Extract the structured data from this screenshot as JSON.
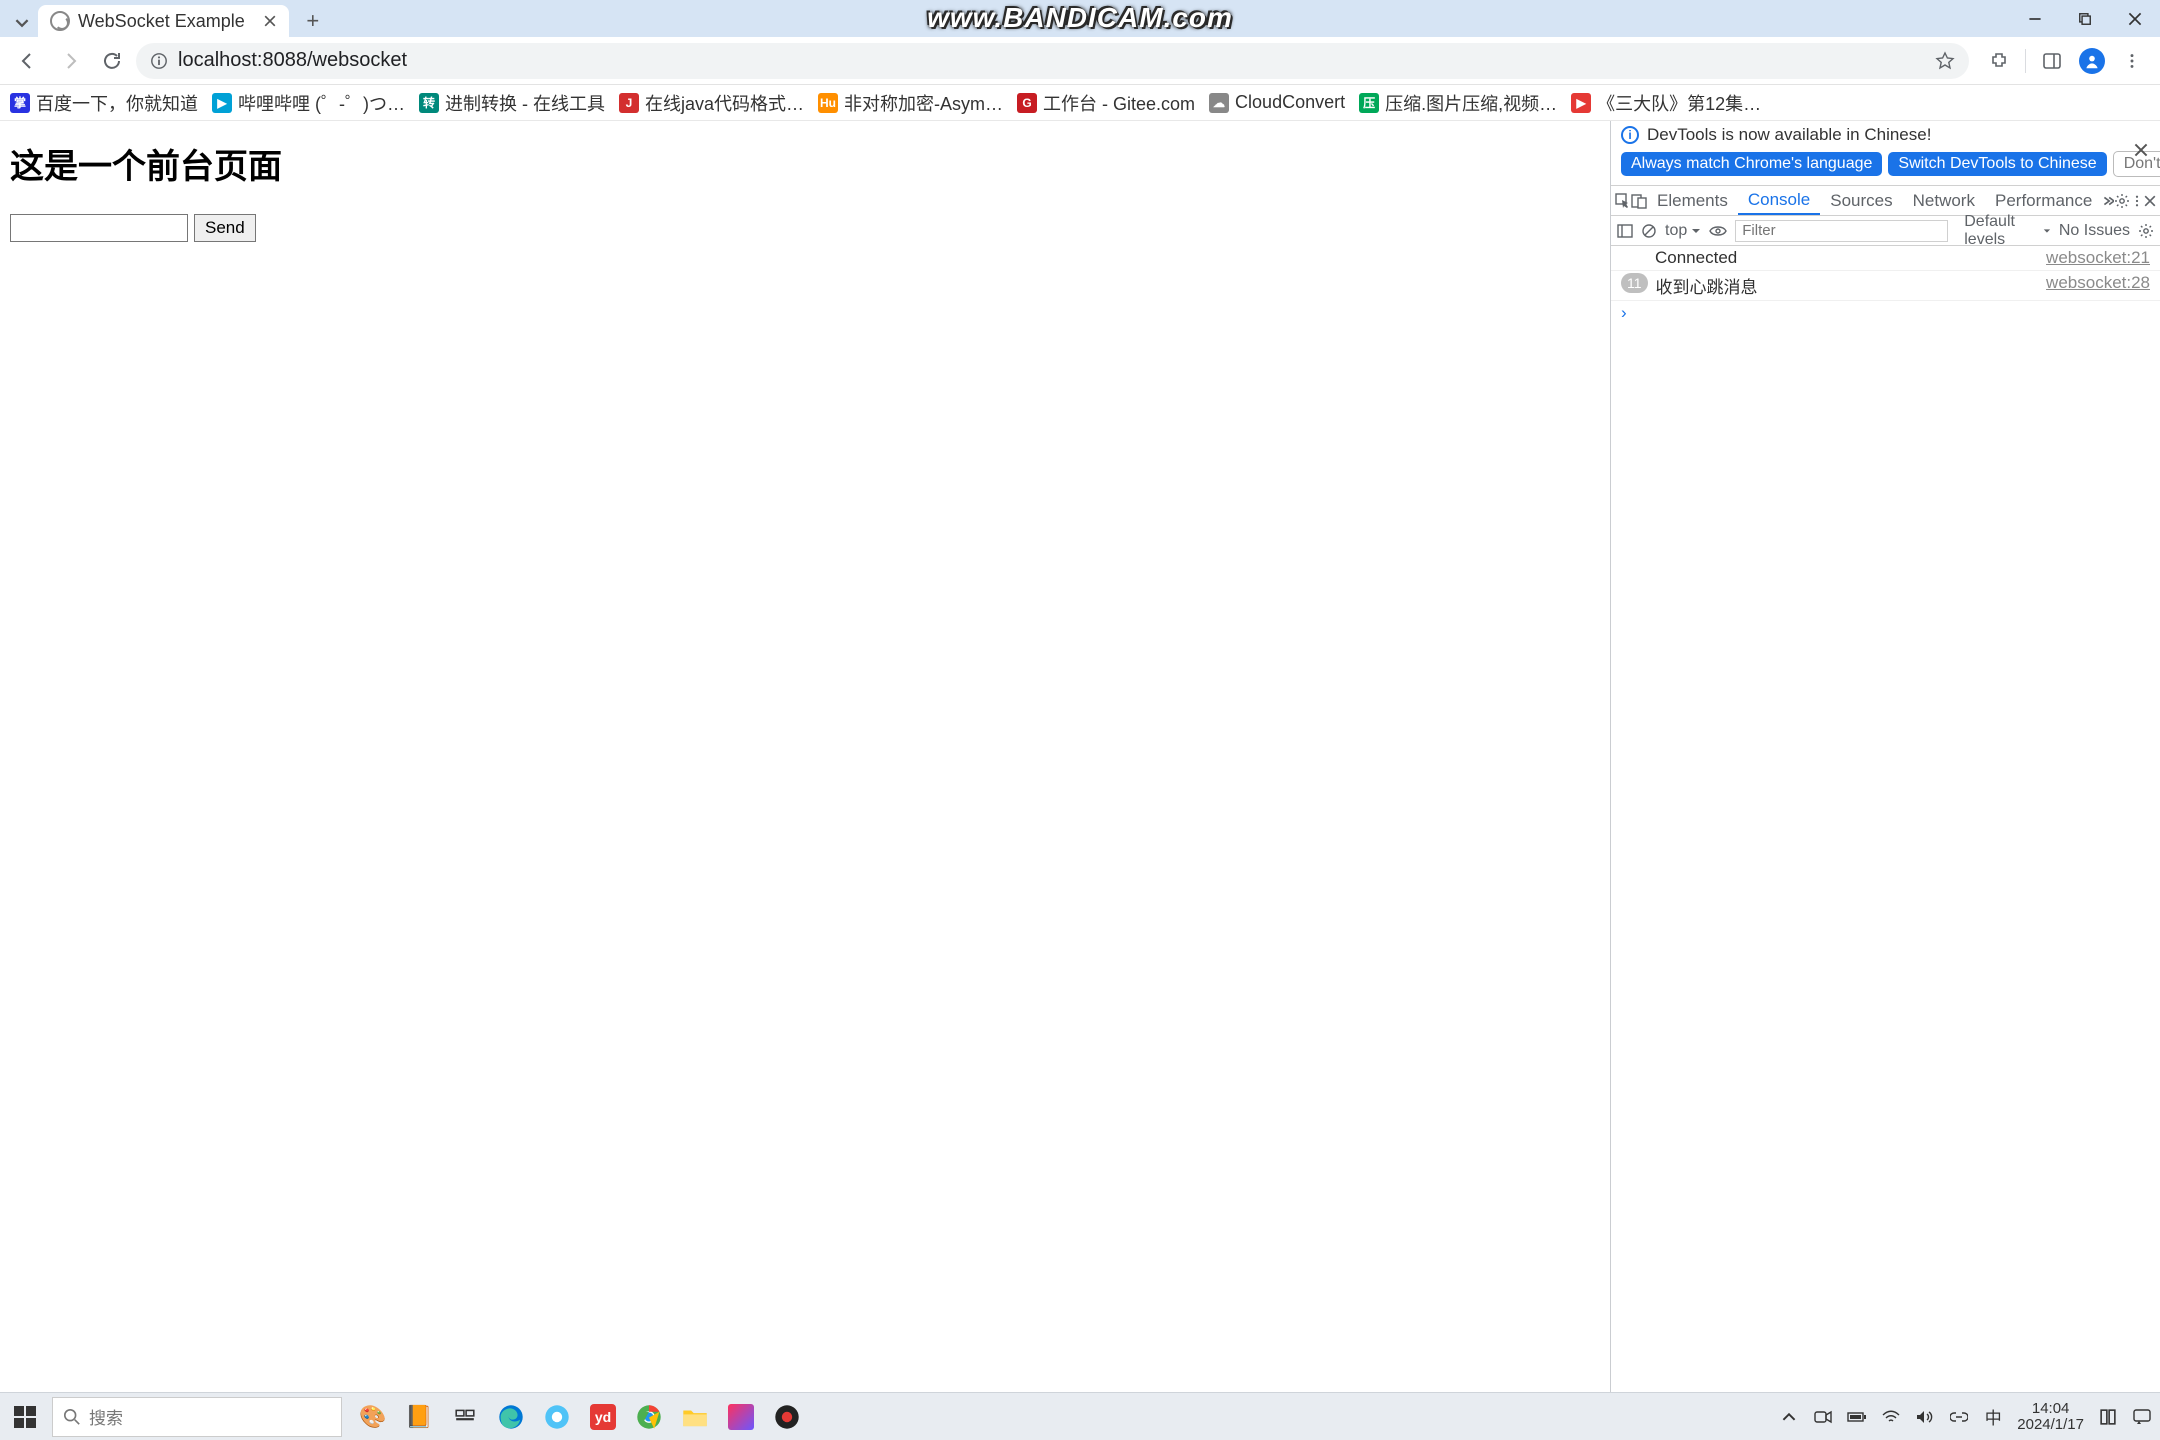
{
  "watermark": "www.BANDICAM.com",
  "tab": {
    "title": "WebSocket Example"
  },
  "url": "localhost:8088/websocket",
  "bookmarks": [
    {
      "label": "百度一下，你就知道",
      "color": "#2932e1",
      "glyph": "掌"
    },
    {
      "label": "哔哩哔哩 (゜-゜)つ…",
      "color": "#00a1d6",
      "glyph": "▶"
    },
    {
      "label": "进制转换 - 在线工具",
      "color": "#00897b",
      "glyph": "转"
    },
    {
      "label": "在线java代码格式…",
      "color": "#d32f2f",
      "glyph": "J"
    },
    {
      "label": "非对称加密-Asym…",
      "color": "#ff8f00",
      "glyph": "Hu"
    },
    {
      "label": "工作台 - Gitee.com",
      "color": "#c71d23",
      "glyph": "G"
    },
    {
      "label": "CloudConvert",
      "color": "#888888",
      "glyph": "☁"
    },
    {
      "label": "压缩.图片压缩,视频…",
      "color": "#00a859",
      "glyph": "压"
    },
    {
      "label": "《三大队》第12集…",
      "color": "#e53935",
      "glyph": "▶"
    }
  ],
  "page": {
    "heading": "这是一个前台页面",
    "sendLabel": "Send"
  },
  "devtools": {
    "banner": {
      "info": "DevTools is now available in Chinese!",
      "btnAlways": "Always match Chrome's language",
      "btnSwitch": "Switch DevTools to Chinese",
      "btnDont": "Don't show again"
    },
    "tabs": [
      "Elements",
      "Console",
      "Sources",
      "Network",
      "Performance"
    ],
    "activeTab": "Console",
    "toolbar": {
      "context": "top",
      "filterPlaceholder": "Filter",
      "levels": "Default levels",
      "issues": "No Issues"
    },
    "logs": [
      {
        "count": null,
        "msg": "Connected",
        "src": "websocket:21"
      },
      {
        "count": 11,
        "msg": "收到心跳消息",
        "src": "websocket:28"
      }
    ]
  },
  "taskbar": {
    "searchPlaceholder": "搜索",
    "time": "14:04",
    "date": "2024/1/17",
    "ime": "中"
  }
}
